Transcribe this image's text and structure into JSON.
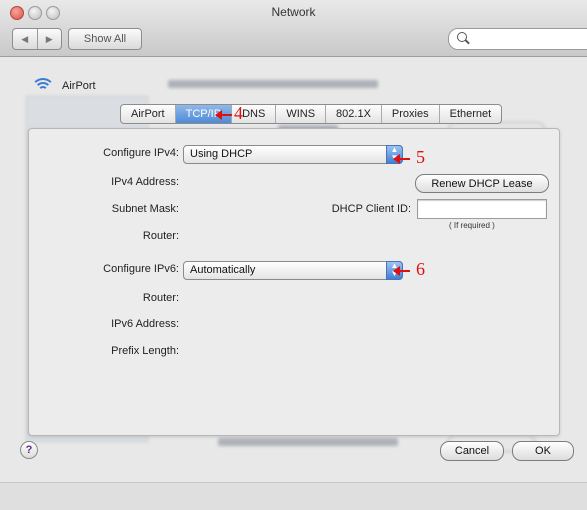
{
  "window": {
    "title": "Network"
  },
  "toolbar": {
    "back": "◀",
    "forward": "▶",
    "show_all": "Show All"
  },
  "sheet": {
    "airport_label": "AirPort",
    "tabs": [
      "AirPort",
      "TCP/IP",
      "DNS",
      "WINS",
      "802.1X",
      "Proxies",
      "Ethernet"
    ],
    "selected_tab": "TCP/IP",
    "ipv4": {
      "configure_label": "Configure IPv4:",
      "configure_value": "Using DHCP",
      "address_label": "IPv4 Address:",
      "subnet_label": "Subnet Mask:",
      "router_label": "Router:",
      "renew_button": "Renew DHCP Lease",
      "dhcp_client_label": "DHCP Client ID:",
      "dhcp_client_value": "",
      "if_required": "( If required )"
    },
    "ipv6": {
      "configure_label": "Configure IPv6:",
      "configure_value": "Automatically",
      "router_label": "Router:",
      "address_label": "IPv6 Address:",
      "prefix_label": "Prefix Length:"
    }
  },
  "annotations": {
    "tab_marker": "4",
    "ipv4_marker": "5",
    "ipv6_marker": "6"
  },
  "footer": {
    "help": "?",
    "cancel": "Cancel",
    "ok": "OK"
  }
}
